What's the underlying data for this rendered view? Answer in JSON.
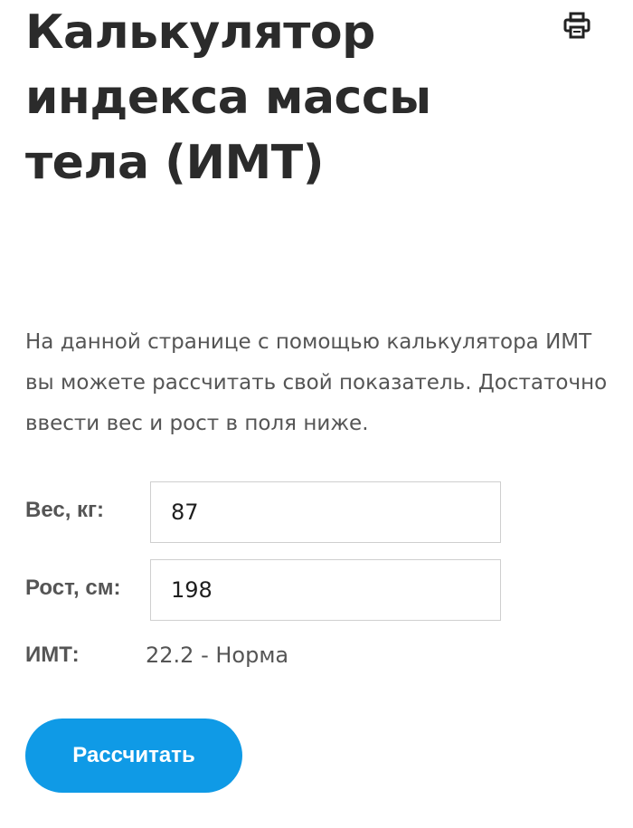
{
  "page": {
    "title": "Калькулятор индекса массы тела (ИМТ)",
    "print_icon": "printer-icon",
    "intro": "На данной странице с помощью калькулятора ИМТ вы можете рассчитать свой показатель. Достаточно ввести вес и рост в поля ниже."
  },
  "form": {
    "weight_label": "Вес, кг:",
    "weight_value": "87",
    "height_label": "Рост, см:",
    "height_value": "198",
    "result_label": "ИМТ:",
    "result_value": "22.2 - Норма",
    "calculate_label": "Рассчитать"
  },
  "colors": {
    "button": "#0f9ae6",
    "title": "#2b2b2b",
    "text": "#555555"
  }
}
